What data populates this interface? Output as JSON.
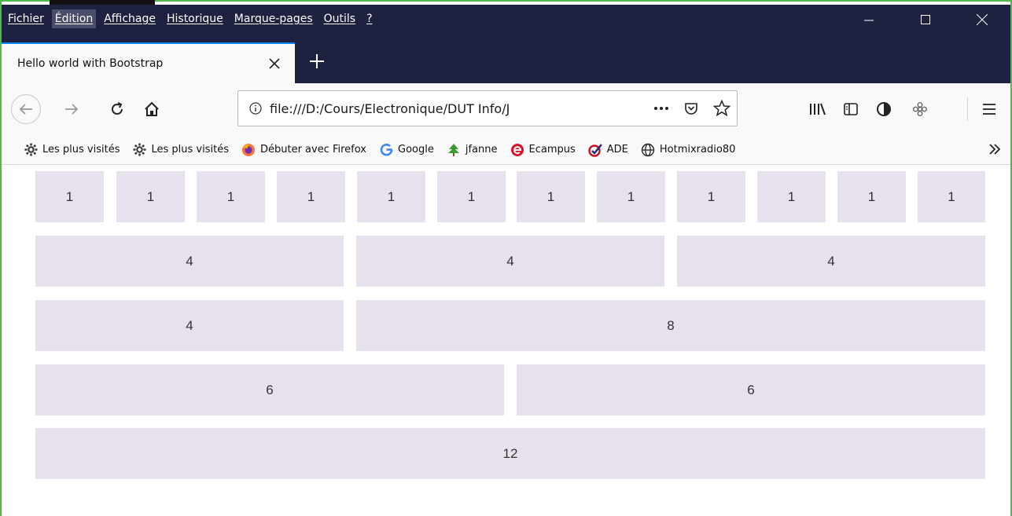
{
  "window": {
    "menu": [
      "Fichier",
      "Édition",
      "Affichage",
      "Historique",
      "Marque-pages",
      "Outils",
      "?"
    ],
    "active_menu_index": 1
  },
  "tab": {
    "title": "Hello world with Bootstrap"
  },
  "navbar": {
    "url": "file:///D:/Cours/Electronique/DUT Info/J"
  },
  "bookmarks": [
    {
      "label": "Les plus visités",
      "icon": "gear-icon"
    },
    {
      "label": "Les plus visités",
      "icon": "gear-icon"
    },
    {
      "label": "Débuter avec Firefox",
      "icon": "firefox-icon"
    },
    {
      "label": "Google",
      "icon": "google-icon"
    },
    {
      "label": "jfanne",
      "icon": "tree-icon"
    },
    {
      "label": "Ecampus",
      "icon": "ecampus-icon"
    },
    {
      "label": "ADE",
      "icon": "ade-icon"
    },
    {
      "label": "Hotmixradio80",
      "icon": "globe-icon"
    }
  ],
  "grid": {
    "cell_color": "#e6e1ec",
    "rows": [
      [
        "1",
        "1",
        "1",
        "1",
        "1",
        "1",
        "1",
        "1",
        "1",
        "1",
        "1",
        "1"
      ],
      [
        "4",
        "4",
        "4"
      ],
      [
        "4",
        "8"
      ],
      [
        "6",
        "6"
      ],
      [
        "12"
      ]
    ]
  }
}
